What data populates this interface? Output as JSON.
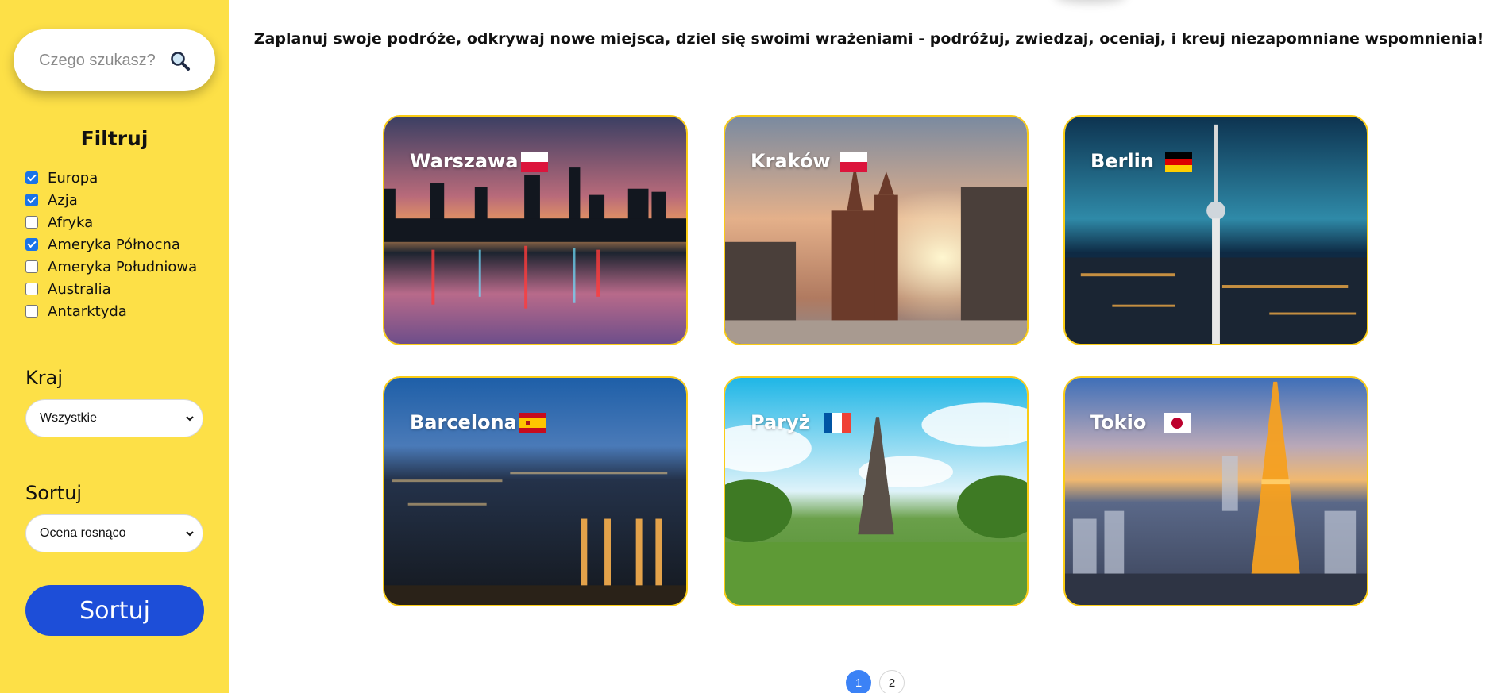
{
  "search": {
    "placeholder": "Czego szukasz?"
  },
  "filters": {
    "title": "Filtruj",
    "items": [
      {
        "label": "Europa",
        "checked": true
      },
      {
        "label": "Azja",
        "checked": true
      },
      {
        "label": "Afryka",
        "checked": false
      },
      {
        "label": "Ameryka Północna",
        "checked": true
      },
      {
        "label": "Ameryka Południowa",
        "checked": false
      },
      {
        "label": "Australia",
        "checked": false
      },
      {
        "label": "Antarktyda",
        "checked": false
      }
    ]
  },
  "country": {
    "label": "Kraj",
    "selected": "Wszystkie"
  },
  "sort": {
    "label": "Sortuj",
    "selected": "Ocena rosnąco",
    "button_label": "Sortuj"
  },
  "tagline": "Zaplanuj swoje podróże, odkrywaj nowe miejsca, dziel się swoimi wrażeniami - podróżuj, zwiedzaj, oceniaj, i kreuj niezapomniane wspomnienia!",
  "cards": [
    {
      "title": "Warszawa",
      "flag": "flag-poland-icon"
    },
    {
      "title": "Kraków",
      "flag": "flag-poland-icon"
    },
    {
      "title": "Berlin",
      "flag": "flag-germany-icon"
    },
    {
      "title": "Barcelona",
      "flag": "flag-spain-icon"
    },
    {
      "title": "Paryż",
      "flag": "flag-france-icon"
    },
    {
      "title": "Tokio",
      "flag": "flag-japan-icon"
    }
  ],
  "pagination": {
    "pages": [
      "1",
      "2"
    ],
    "current": "1"
  },
  "colors": {
    "sidebar": "#fde047",
    "accent": "#1d4ed8",
    "card_border": "#facc15",
    "page_active": "#3b82f6"
  }
}
